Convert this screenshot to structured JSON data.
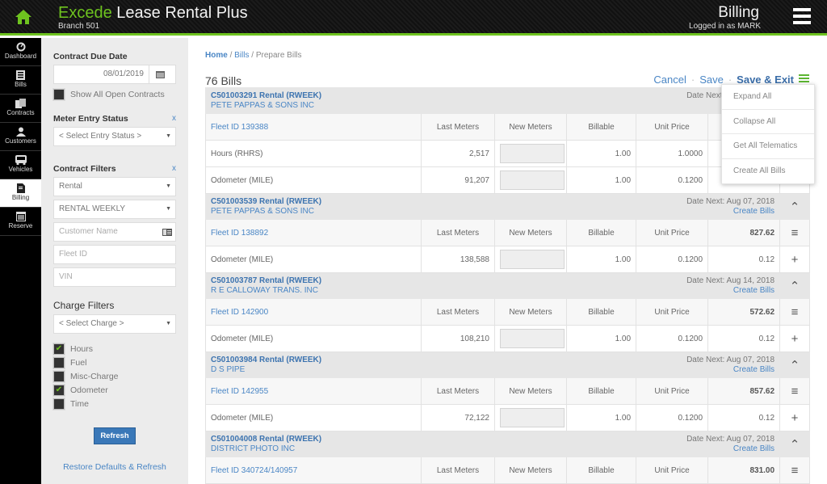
{
  "header": {
    "brand_green": "Excede",
    "brand_rest": "Lease Rental Plus",
    "branch": "Branch 501",
    "page_title": "Billing",
    "logged_in": "Logged in as MARK"
  },
  "colors": {
    "accent_green": "#6ec31f",
    "link_blue": "#4a86c5",
    "button_blue": "#3a78b8"
  },
  "nav": [
    {
      "label": "Dashboard",
      "icon": "dashboard-icon"
    },
    {
      "label": "Bills",
      "icon": "bills-icon"
    },
    {
      "label": "Contracts",
      "icon": "contracts-icon"
    },
    {
      "label": "Customers",
      "icon": "customers-icon"
    },
    {
      "label": "Vehicles",
      "icon": "vehicles-icon"
    },
    {
      "label": "Billing",
      "icon": "billing-icon",
      "active": true
    },
    {
      "label": "Reserve",
      "icon": "reserve-icon"
    }
  ],
  "filters": {
    "due_date_label": "Contract Due Date",
    "due_date_value": "08/01/2019",
    "show_open_label": "Show All Open Contracts",
    "meter_status_label": "Meter Entry Status",
    "meter_status_value": "< Select Entry Status >",
    "clear": "x",
    "contract_filters_label": "Contract Filters",
    "contract_type": "Rental",
    "rental_period": "RENTAL WEEKLY",
    "customer_placeholder": "Customer Name",
    "fleet_placeholder": "Fleet ID",
    "vin_placeholder": "VIN",
    "charge_filters_label": "Charge Filters",
    "charge_value": "< Select Charge >",
    "charges": [
      {
        "label": "Hours",
        "checked": true
      },
      {
        "label": "Fuel",
        "checked": false
      },
      {
        "label": "Misc-Charge",
        "checked": false
      },
      {
        "label": "Odometer",
        "checked": true
      },
      {
        "label": "Time",
        "checked": false
      }
    ],
    "refresh": "Refresh",
    "restore": "Restore Defaults & Refresh"
  },
  "main": {
    "breadcrumb": {
      "home": "Home",
      "bills": "Bills",
      "current": "Prepare Bills",
      "sep": "/"
    },
    "count": "76 Bills",
    "actions": {
      "cancel": "Cancel",
      "save": "Save",
      "save_exit": "Save & Exit",
      "sep": "·"
    },
    "menu": [
      "Expand All",
      "Collapse All",
      "Get All Telematics",
      "Create All Bills"
    ],
    "columns": {
      "last": "Last Meters",
      "new": "New Meters",
      "billable": "Billable",
      "unit": "Unit Price"
    },
    "create_bills": "Create Bills",
    "contracts": [
      {
        "id": "C501003291 Rental (RWEEK)",
        "customer": "PETE PAPPAS & SONS INC",
        "date_next": "Date Next: Aug 07, 2018",
        "fleet": "Fleet ID 139388",
        "total": "",
        "rows": [
          {
            "meter": "Hours (RHRS)",
            "last": "2,517",
            "billable": "1.00",
            "unit": "1.0000",
            "amount": ""
          },
          {
            "meter": "Odometer (MILE)",
            "last": "91,207",
            "billable": "1.00",
            "unit": "0.1200",
            "amount": ""
          }
        ]
      },
      {
        "id": "C501003539 Rental (RWEEK)",
        "customer": "PETE PAPPAS & SONS INC",
        "date_next": "Date Next: Aug 07, 2018",
        "fleet": "Fleet ID 138892",
        "total": "827.62",
        "rows": [
          {
            "meter": "Odometer (MILE)",
            "last": "138,588",
            "billable": "1.00",
            "unit": "0.1200",
            "amount": "0.12"
          }
        ]
      },
      {
        "id": "C501003787 Rental (RWEEK)",
        "customer": "R E CALLOWAY TRANS. INC",
        "date_next": "Date Next: Aug 14, 2018",
        "fleet": "Fleet ID 142900",
        "total": "572.62",
        "rows": [
          {
            "meter": "Odometer (MILE)",
            "last": "108,210",
            "billable": "1.00",
            "unit": "0.1200",
            "amount": "0.12"
          }
        ]
      },
      {
        "id": "C501003984 Rental (RWEEK)",
        "customer": "D S PIPE",
        "date_next": "Date Next: Aug 07, 2018",
        "fleet": "Fleet ID 142955",
        "total": "857.62",
        "rows": [
          {
            "meter": "Odometer (MILE)",
            "last": "72,122",
            "billable": "1.00",
            "unit": "0.1200",
            "amount": "0.12"
          }
        ]
      },
      {
        "id": "C501004008 Rental (RWEEK)",
        "customer": "DISTRICT PHOTO INC",
        "date_next": "Date Next: Aug 07, 2018",
        "fleet": "Fleet ID 340724/140957",
        "total": "831.00",
        "rows": []
      }
    ]
  }
}
